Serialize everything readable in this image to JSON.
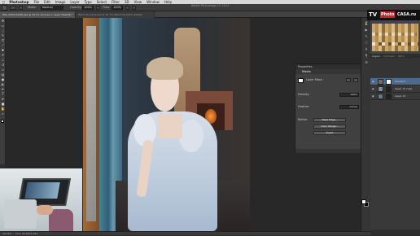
{
  "menubar": {
    "apple": "",
    "app": "Photoshop",
    "items": [
      "File",
      "Edit",
      "Image",
      "Layer",
      "Type",
      "Select",
      "Filter",
      "3D",
      "View",
      "Window",
      "Help"
    ]
  },
  "window_title": "Adobe Photoshop CC 2014",
  "options": {
    "mode_label": "Mode:",
    "mode_value": "Normal",
    "opacity_label": "Opacity:",
    "opacity_value": "100%",
    "flow_label": "Flow:",
    "flow_value": "100%"
  },
  "tabs": [
    {
      "label": "IMG_9509-HAND.psd @ 16.1% (Curves 1, Layer Mask/8) *"
    },
    {
      "label": "IMG3_09_0322.psd @ 16.7% (IMG3-09-0322, RGB/8)"
    }
  ],
  "status": {
    "zoom": "16.16%",
    "doc": "Doc: 85.0M/1.58G"
  },
  "properties": {
    "header": "Properties",
    "section": "Masks",
    "mask_type": "Layer Mask",
    "density_label": "Density:",
    "density_value": "100%",
    "feather_label": "Feather:",
    "feather_value": "0.0 px",
    "refine_label": "Refine:",
    "btn_mask_edge": "Mask Edge...",
    "btn_color_range": "Color Range...",
    "btn_invert": "Invert"
  },
  "logo": {
    "tv": "TV",
    "photo": "Photo",
    "casa": "CASA.ru"
  },
  "layers": {
    "tabs": [
      "Layers",
      "Channels",
      "Paths"
    ],
    "rows": [
      {
        "name": "Curves 1",
        "selected": true
      },
      {
        "name": "Layer 13 copy",
        "selected": false
      },
      {
        "name": "Layer 13",
        "selected": false
      }
    ]
  },
  "colors": {
    "selection": "#4a6a8e",
    "panel": "#3b3b3b"
  }
}
